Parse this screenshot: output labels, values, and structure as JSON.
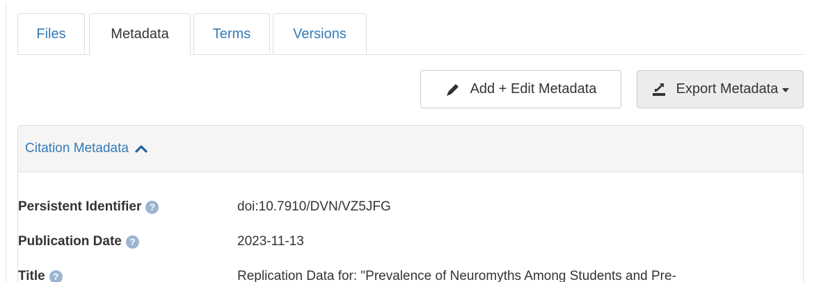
{
  "tabs": [
    {
      "label": "Files",
      "active": false
    },
    {
      "label": "Metadata",
      "active": true
    },
    {
      "label": "Terms",
      "active": false
    },
    {
      "label": "Versions",
      "active": false
    }
  ],
  "toolbar": {
    "edit_label": "Add + Edit Metadata",
    "export_label": "Export Metadata"
  },
  "citation": {
    "heading": "Citation Metadata",
    "fields": [
      {
        "label": "Persistent Identifier",
        "value": "doi:10.7910/DVN/VZ5JFG"
      },
      {
        "label": "Publication Date",
        "value": "2023-11-13"
      },
      {
        "label": "Title",
        "value": "Replication Data for: \"Prevalence of Neuromyths Among Students and Pre-"
      }
    ]
  },
  "colors": {
    "link": "#337ab7",
    "help_icon": "#9ab4d1",
    "panel_heading": "#f5f5f5",
    "export_button": "#ececec"
  },
  "icons": {
    "edit": "pencil-icon",
    "export": "export-icon",
    "collapse": "chevron-up-icon",
    "help": "question-circle-icon"
  }
}
